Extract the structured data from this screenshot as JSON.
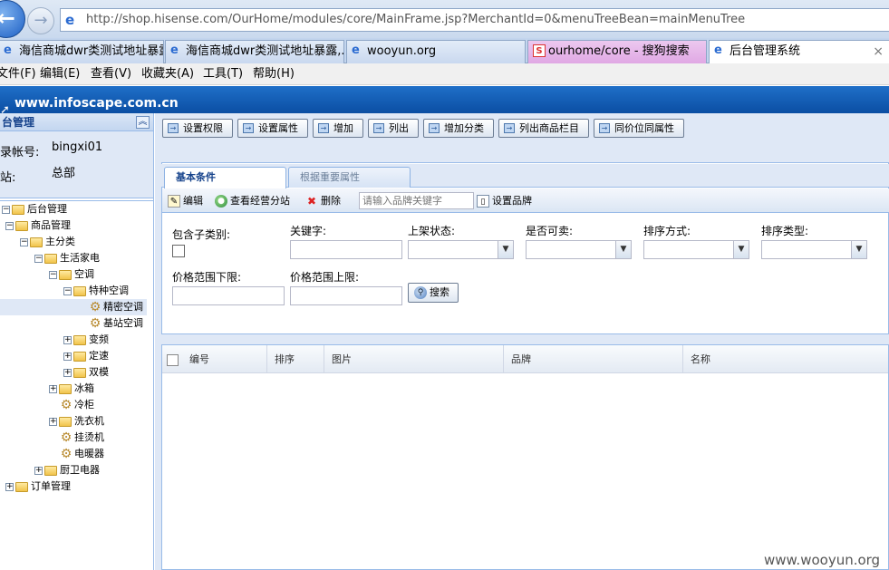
{
  "browser": {
    "url": "http://shop.hisense.com/OurHome/modules/core/MainFrame.jsp?MerchantId=0&menuTreeBean=mainMenuTree",
    "tabs": [
      {
        "label": "海信商城dwr类测试地址暴露,..."
      },
      {
        "label": "海信商城dwr类测试地址暴露,..."
      },
      {
        "label": "wooyun.org"
      },
      {
        "label": "ourhome/core - 搜狗搜索"
      },
      {
        "label": "后台管理系统"
      }
    ],
    "menu": [
      "文件(F)",
      "编辑(E)",
      "查看(V)",
      "收藏夹(A)",
      "工具(T)",
      "帮助(H)"
    ]
  },
  "header": {
    "site": "www.infoscape.com.cn"
  },
  "left": {
    "title": "台管理",
    "account_label": "录帐号:",
    "account_value": "bingxi01",
    "site_label": "站:",
    "site_value": "总部",
    "tree": [
      {
        "label": "后台管理"
      },
      {
        "label": "商品管理"
      },
      {
        "label": "主分类"
      },
      {
        "label": "生活家电"
      },
      {
        "label": "空调"
      },
      {
        "label": "特种空调"
      },
      {
        "label": "精密空调"
      },
      {
        "label": "基站空调"
      },
      {
        "label": "变频"
      },
      {
        "label": "定速"
      },
      {
        "label": "双模"
      },
      {
        "label": "冰箱"
      },
      {
        "label": "冷柜"
      },
      {
        "label": "洗衣机"
      },
      {
        "label": "挂烫机"
      },
      {
        "label": "电暖器"
      },
      {
        "label": "厨卫电器"
      },
      {
        "label": "订单管理"
      }
    ]
  },
  "toolbar": [
    "设置权限",
    "设置属性",
    "增加",
    "列出",
    "增加分类",
    "列出商品栏目",
    "同价位同属性"
  ],
  "panel_tabs": [
    "基本条件",
    "根据重要属性"
  ],
  "subbar": {
    "edit": "编辑",
    "view_sites": "查看经营分站",
    "delete": "删除",
    "brand_placeholder": "请输入品牌关键字",
    "set_brand": "设置品牌"
  },
  "form": {
    "include_sub": "包含子类别:",
    "keyword": "关键字:",
    "shelf_status": "上架状态:",
    "sellable": "是否可卖:",
    "sort_method": "排序方式:",
    "sort_type": "排序类型:",
    "price_low": "价格范围下限:",
    "price_high": "价格范围上限:",
    "search": "搜索"
  },
  "grid": {
    "columns": [
      "编号",
      "排序",
      "图片",
      "品牌",
      "名称"
    ]
  },
  "watermark": "www.wooyun.org"
}
